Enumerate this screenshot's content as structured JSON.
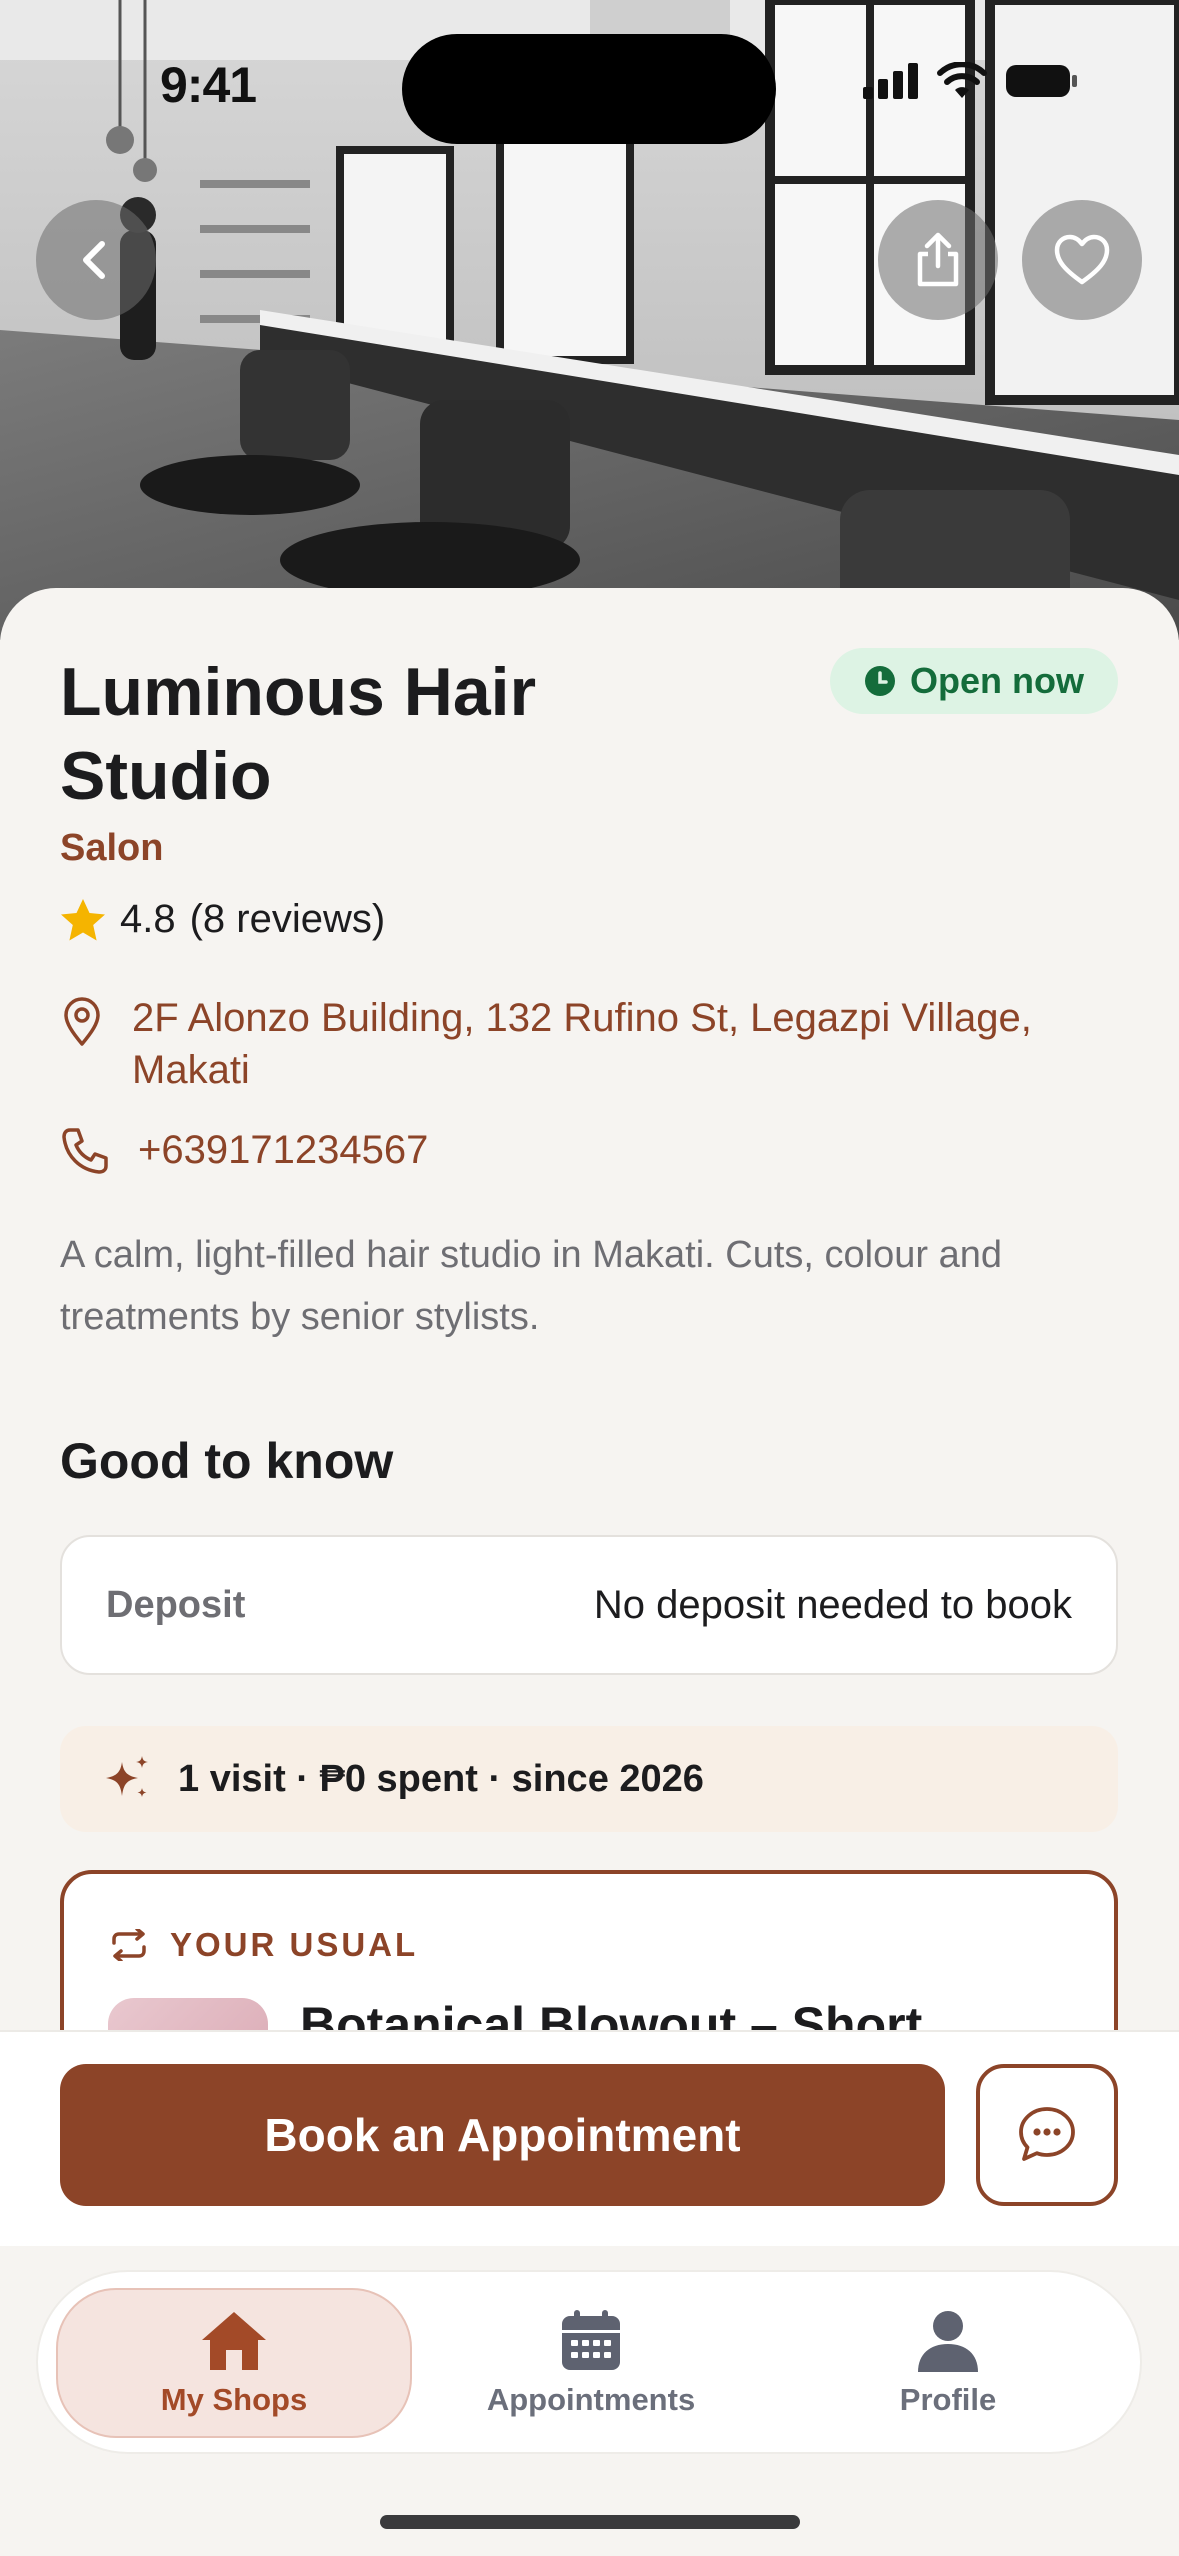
{
  "status_bar": {
    "time": "9:41"
  },
  "shop": {
    "name": "Luminous Hair Studio",
    "category": "Salon",
    "status": "Open now",
    "rating": "4.8",
    "reviews": "(8 reviews)",
    "address": "2F Alonzo Building, 132 Rufino St, Legazpi Village, Makati",
    "phone": "+639171234567",
    "description": "A calm, light-filled hair studio in Makati. Cuts, colour and treatments by senior stylists."
  },
  "good_to_know": {
    "title": "Good to know",
    "deposit_label": "Deposit",
    "deposit_value": "No deposit needed to book"
  },
  "loyalty": {
    "text": "1 visit · ₱0 spent · since 2026"
  },
  "your_usual": {
    "label": "YOUR USUAL",
    "service": "Botanical Blowout – Short"
  },
  "actions": {
    "book": "Book an Appointment"
  },
  "tabbar": {
    "tabs": [
      {
        "label": "My Shops",
        "active": true
      },
      {
        "label": "Appointments",
        "active": false
      },
      {
        "label": "Profile",
        "active": false
      }
    ]
  },
  "colors": {
    "accent": "#8C4428",
    "open_bg": "#DDF3E4",
    "open_text": "#146C3B",
    "star": "#F5B400"
  }
}
